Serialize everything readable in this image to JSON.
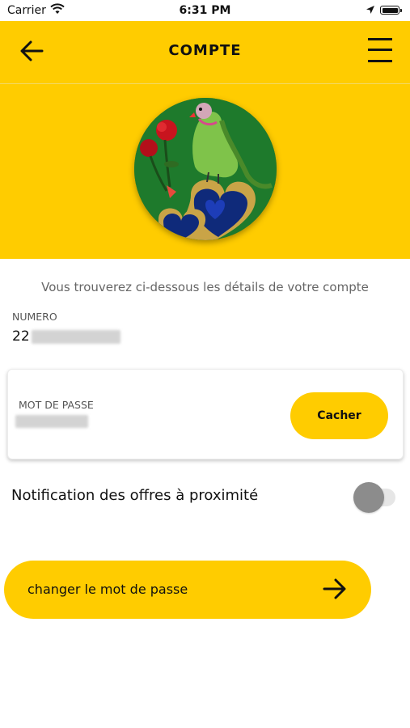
{
  "status_bar": {
    "carrier": "Carrier",
    "time": "6:31 PM"
  },
  "header": {
    "title": "COMPTE",
    "back_icon": "arrow-left-icon",
    "menu_icon": "hamburger-menu-icon"
  },
  "profile": {
    "avatar": "parrot-with-roses-and-hearts"
  },
  "account": {
    "intro": "Vous trouverez ci-dessous les détails de votre compte",
    "numero_label": "NUMERO",
    "numero_value": "22",
    "password_label": "MOT DE PASSE",
    "hide_button": "Cacher"
  },
  "notifications": {
    "label": "Notification des offres à proximité",
    "enabled": false
  },
  "actions": {
    "change_password": "changer le mot de passe",
    "arrow_icon": "arrow-right-icon"
  },
  "colors": {
    "accent": "#FFCC00",
    "text": "#111111",
    "muted": "#666666"
  }
}
